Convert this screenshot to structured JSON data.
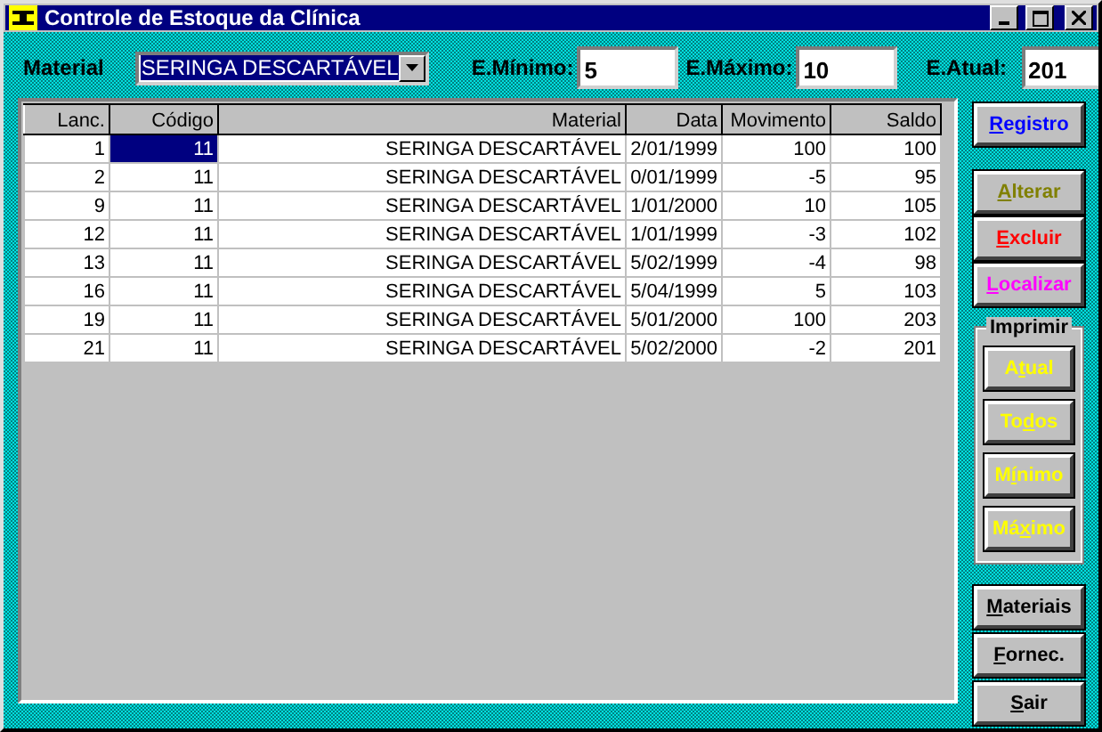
{
  "window": {
    "title": "Controle de Estoque da Clínica"
  },
  "filters": {
    "material_label": "Material",
    "material_value": "SERINGA DESCARTÁVEL",
    "minimo_label": "E.Mínimo:",
    "minimo_value": "5",
    "maximo_label": "E.Máximo:",
    "maximo_value": "10",
    "atual_label": "E.Atual:",
    "atual_value": "201"
  },
  "table": {
    "columns": [
      "Lanc.",
      "Código",
      "Material",
      "Data",
      "Movimento",
      "Saldo"
    ],
    "rows": [
      {
        "cells": [
          "1",
          "11",
          "SERINGA DESCARTÁVEL",
          "2/01/1999",
          "100",
          "100"
        ],
        "selected": true
      },
      {
        "cells": [
          "2",
          "11",
          "SERINGA DESCARTÁVEL",
          "0/01/1999",
          "-5",
          "95"
        ],
        "selected": false
      },
      {
        "cells": [
          "9",
          "11",
          "SERINGA DESCARTÁVEL",
          "1/01/2000",
          "10",
          "105"
        ],
        "selected": false
      },
      {
        "cells": [
          "12",
          "11",
          "SERINGA DESCARTÁVEL",
          "1/01/1999",
          "-3",
          "102"
        ],
        "selected": false
      },
      {
        "cells": [
          "13",
          "11",
          "SERINGA DESCARTÁVEL",
          "5/02/1999",
          "-4",
          "98"
        ],
        "selected": false
      },
      {
        "cells": [
          "16",
          "11",
          "SERINGA DESCARTÁVEL",
          "5/04/1999",
          "5",
          "103"
        ],
        "selected": false
      },
      {
        "cells": [
          "19",
          "11",
          "SERINGA DESCARTÁVEL",
          "5/01/2000",
          "100",
          "203"
        ],
        "selected": false
      },
      {
        "cells": [
          "21",
          "11",
          "SERINGA DESCARTÁVEL",
          "5/02/2000",
          "-2",
          "201"
        ],
        "selected": false
      }
    ]
  },
  "actions": [
    {
      "key": "R",
      "rest": "egistro",
      "color": "#0000ff"
    }
  ],
  "edit_actions": [
    {
      "key": "A",
      "rest": "lterar",
      "color": "#808000"
    },
    {
      "key": "E",
      "rest": "xcluir",
      "color": "#ff0000"
    },
    {
      "key": "L",
      "rest": "ocalizar",
      "color": "#ff00ff"
    }
  ],
  "print_group": {
    "title": "Imprimir",
    "buttons": [
      {
        "lead": "A",
        "key": "t",
        "rest": "ual",
        "color": "#ffff00"
      },
      {
        "lead": "To",
        "key": "d",
        "rest": "os",
        "color": "#ffff00"
      },
      {
        "lead": "M",
        "key": "í",
        "rest": "nimo",
        "color": "#ffff00"
      },
      {
        "lead": "Má",
        "key": "x",
        "rest": "imo",
        "color": "#ffff00"
      }
    ]
  },
  "bottom_actions": [
    {
      "key": "M",
      "rest": "ateriais",
      "color": "#000000"
    },
    {
      "key": "F",
      "rest": "ornec.",
      "color": "#000000"
    },
    {
      "key": "S",
      "rest": "air",
      "color": "#000000"
    }
  ]
}
